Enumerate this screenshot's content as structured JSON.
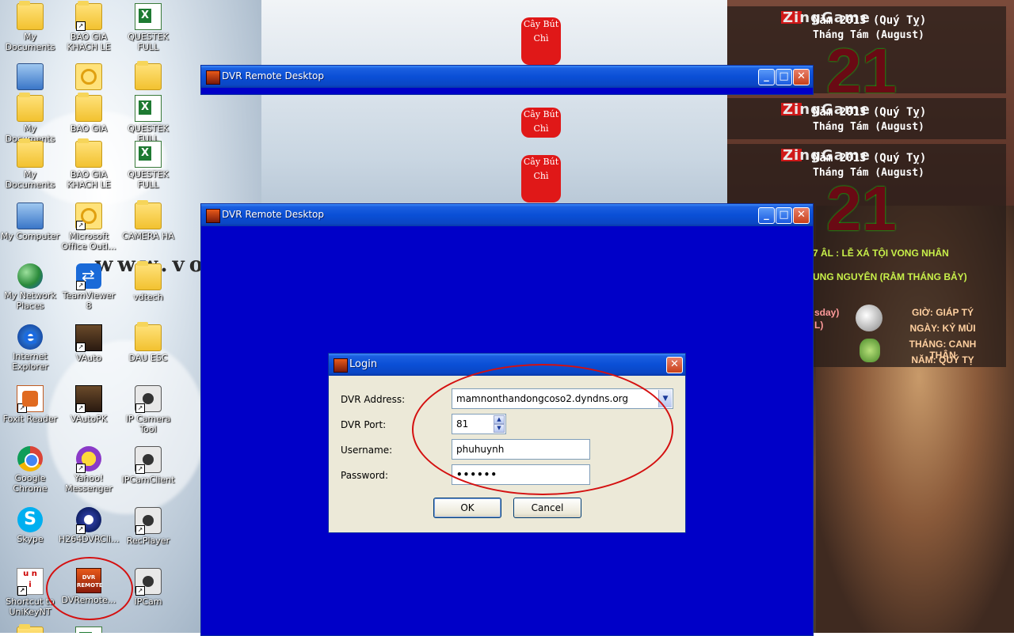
{
  "desktop_icons": [
    {
      "label": "My Documents",
      "icon": "documents-folder-icon"
    },
    {
      "label": "BAO GIA KHACH LE",
      "icon": "folder-icon"
    },
    {
      "label": "QUESTEK FULL",
      "icon": "excel-file-icon"
    },
    {
      "label": "My Computer",
      "icon": "computer-icon"
    },
    {
      "label": "Microsoft Office Outl...",
      "icon": "outlook-icon"
    },
    {
      "label": "CAMERA HA",
      "icon": "folder-icon"
    },
    {
      "label": "My Network Places",
      "icon": "network-places-icon"
    },
    {
      "label": "TeamViewer 8",
      "icon": "teamviewer-icon"
    },
    {
      "label": "vdtech",
      "icon": "folder-icon"
    },
    {
      "label": "Internet Explorer",
      "icon": "internet-explorer-icon"
    },
    {
      "label": "VAuto",
      "icon": "vauto-icon"
    },
    {
      "label": "DAU ESC",
      "icon": "folder-icon"
    },
    {
      "label": "Foxit Reader",
      "icon": "foxit-reader-icon"
    },
    {
      "label": "VAutoPK",
      "icon": "vautopk-icon"
    },
    {
      "label": "IP Camera Tool",
      "icon": "ip-camera-tool-icon"
    },
    {
      "label": "Google Chrome",
      "icon": "chrome-icon"
    },
    {
      "label": "Yahoo! Messenger",
      "icon": "yahoo-messenger-icon"
    },
    {
      "label": "IPCamClient",
      "icon": "ipcamclient-icon"
    },
    {
      "label": "Skype",
      "icon": "skype-icon"
    },
    {
      "label": "H264DVRCli...",
      "icon": "h264dvr-icon"
    },
    {
      "label": "RecPlayer",
      "icon": "recplayer-icon"
    },
    {
      "label": "Shortcut to UniKeyNT",
      "icon": "unikey-icon"
    },
    {
      "label": "DVRemote...",
      "icon": "dvr-remote-icon"
    },
    {
      "label": "IPCam",
      "icon": "ipcam-icon"
    }
  ],
  "background_text": {
    "website": "www.vol",
    "stamp": "Cây Bút Chì"
  },
  "calendar": {
    "brand": "ZingGame",
    "year": "Năm 2013 (Quý Tỵ)",
    "month": "Tháng Tám (August)",
    "day": "21",
    "event1": "7 ÂL : LỄ XÁ TỘI VONG NHÂN",
    "event2": "UNG NGUYÊN (RẰM THÁNG BẢY)",
    "weekday_partial1": "sday)",
    "weekday_partial2": "L)",
    "hour": "GIỜ: GIÁP TÝ",
    "day_cycle": "NGÀY: KỶ MÙI",
    "month_cycle": "THÁNG: CANH THÂN",
    "year_cycle": "NĂM: QUÝ TỴ"
  },
  "windows": {
    "top_title": "DVR Remote Desktop",
    "main_title": "DVR Remote Desktop",
    "minimize": "_",
    "maximize": "□",
    "close": "✕"
  },
  "login": {
    "title": "Login",
    "dvr_address_label": "DVR Address:",
    "dvr_address_value": "mamnonthandongcoso2.dyndns.org",
    "dvr_port_label": "DVR Port:",
    "dvr_port_value": "81",
    "username_label": "Username:",
    "username_value": "phuhuynh",
    "password_label": "Password:",
    "password_value": "••••••",
    "ok_label": "OK",
    "cancel_label": "Cancel"
  },
  "colors": {
    "annotation": "#d41010",
    "titlebar": "#0a4fd6",
    "window_body": "#0000c8"
  }
}
